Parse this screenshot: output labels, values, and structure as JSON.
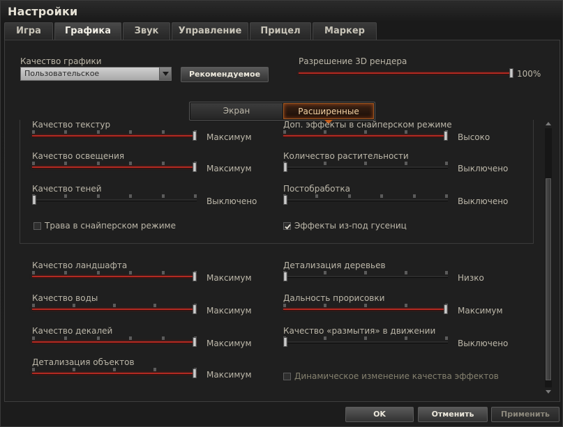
{
  "window": {
    "title": "Настройки"
  },
  "tabs": [
    {
      "label": "Игра",
      "active": false
    },
    {
      "label": "Графика",
      "active": true
    },
    {
      "label": "Звук",
      "active": false
    },
    {
      "label": "Управление",
      "active": false
    },
    {
      "label": "Прицел",
      "active": false
    },
    {
      "label": "Маркер",
      "active": false
    }
  ],
  "quality": {
    "label": "Качество графики",
    "value": "Пользовательское",
    "recommended_label": "Рекомендуемое"
  },
  "render": {
    "label": "Разрешение 3D рендера",
    "value": "100%",
    "level": 1.0
  },
  "mode_switch": {
    "screen_label": "Экран",
    "advanced_label": "Расширенные",
    "selected": "Расширенные"
  },
  "settings_left": [
    {
      "label": "Качество текстур",
      "value": "Максимум",
      "level": 1.0
    },
    {
      "label": "Качество освещения",
      "value": "Максимум",
      "level": 1.0
    },
    {
      "label": "Качество теней",
      "value": "Выключено",
      "level": 0.0
    },
    {
      "label": "Качество ландшафта",
      "value": "Максимум",
      "level": 1.0
    },
    {
      "label": "Качество воды",
      "value": "Максимум",
      "level": 1.0
    },
    {
      "label": "Качество декалей",
      "value": "Максимум",
      "level": 1.0
    },
    {
      "label": "Детализация объектов",
      "value": "Максимум",
      "level": 1.0
    }
  ],
  "settings_right": [
    {
      "label": "Доп. эффекты в снайперском режиме",
      "value": "Высоко",
      "level": 1.0
    },
    {
      "label": "Количество растительности",
      "value": "Выключено",
      "level": 0.0
    },
    {
      "label": "Постобработка",
      "value": "Выключено",
      "level": 0.0
    },
    {
      "label": "Детализация деревьев",
      "value": "Низко",
      "level": 0.0
    },
    {
      "label": "Дальность прорисовки",
      "value": "Максимум",
      "level": 1.0
    },
    {
      "label": "Качество «размытия» в движении",
      "value": "Выключено",
      "level": 0.0
    }
  ],
  "checkboxes": {
    "grass": {
      "label": "Трава в снайперском режиме",
      "checked": false
    },
    "track_effects": {
      "label": "Эффекты из-под гусениц",
      "checked": true
    },
    "dynamic_effects": {
      "label": "Динамическое изменение качества эффектов",
      "checked": false
    }
  },
  "footer": {
    "ok_label": "OK",
    "cancel_label": "Отменить",
    "apply_label": "Применить"
  },
  "colors": {
    "slider_fill": "#b22a22",
    "accent": "#c45a1a",
    "background": "#1f1f1f"
  }
}
